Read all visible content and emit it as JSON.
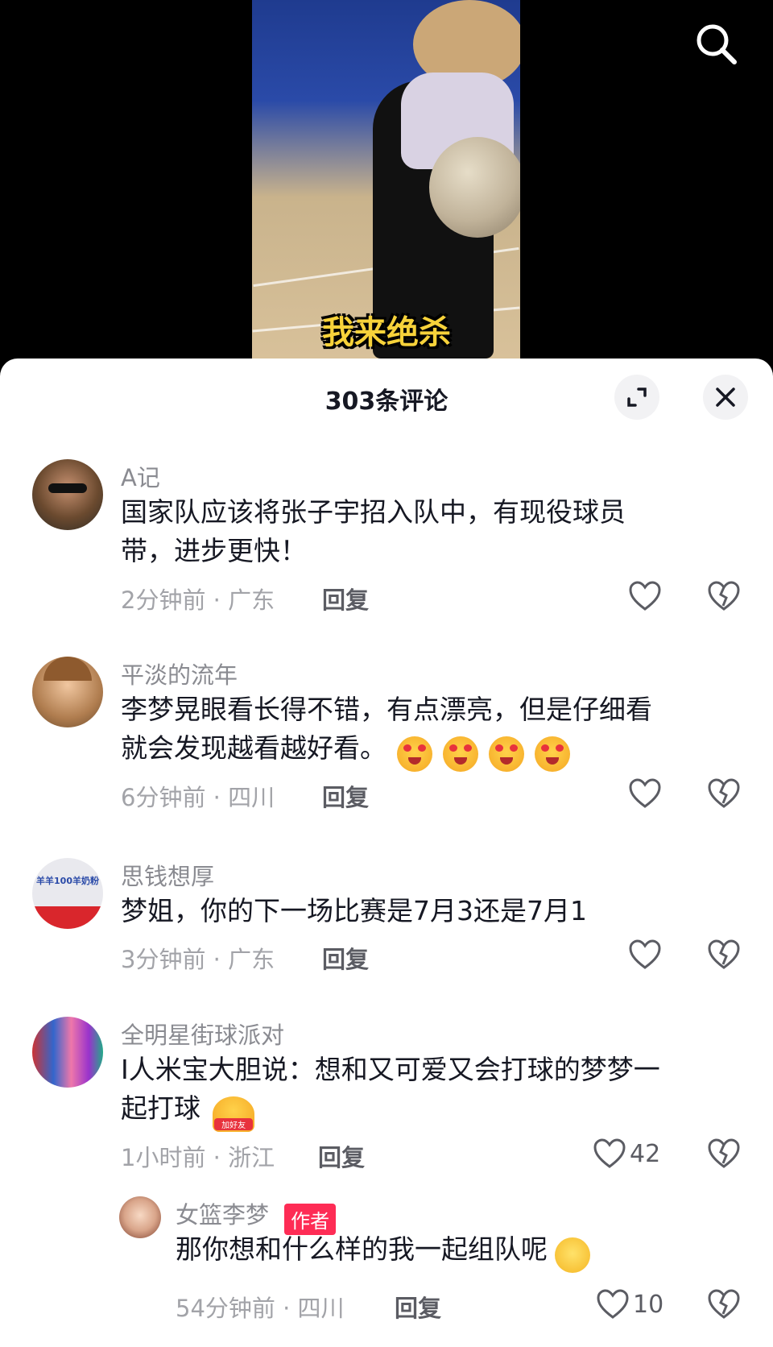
{
  "video": {
    "caption": "我来绝杀"
  },
  "sheet": {
    "title": "303条评论"
  },
  "comments": [
    {
      "user": "A记",
      "text1": "国家队应该将张子宇招入队中，有现役球员",
      "text2": "带，进步更快！",
      "meta": "2分钟前 · 广东",
      "reply": "回复",
      "likes": ""
    },
    {
      "user": "平淡的流年",
      "text1": "李梦晃眼看长得不错，有点漂亮，但是仔细看",
      "text2": "就会发现越看越好看。",
      "meta": "6分钟前 · 四川",
      "reply": "回复",
      "likes": ""
    },
    {
      "user": "思钱想厚",
      "text1": "梦姐，你的下一场比赛是7月3还是7月1",
      "meta": "3分钟前 · 广东",
      "reply": "回复",
      "likes": "",
      "avatar_text": "羊羊100羊奶粉"
    },
    {
      "user": "全明星街球派对",
      "text1": "I人米宝大胆说：想和又可爱又会打球的梦梦一",
      "text2": "起打球",
      "meta": "1小时前 · 浙江",
      "reply": "回复",
      "likes": "42",
      "sticker": "加好友"
    }
  ],
  "reply_comment": {
    "user": "女篮李梦",
    "badge": "作者",
    "text": "那你想和什么样的我一起组队呢",
    "meta": "54分钟前 · 四川",
    "reply": "回复",
    "likes": "10"
  }
}
